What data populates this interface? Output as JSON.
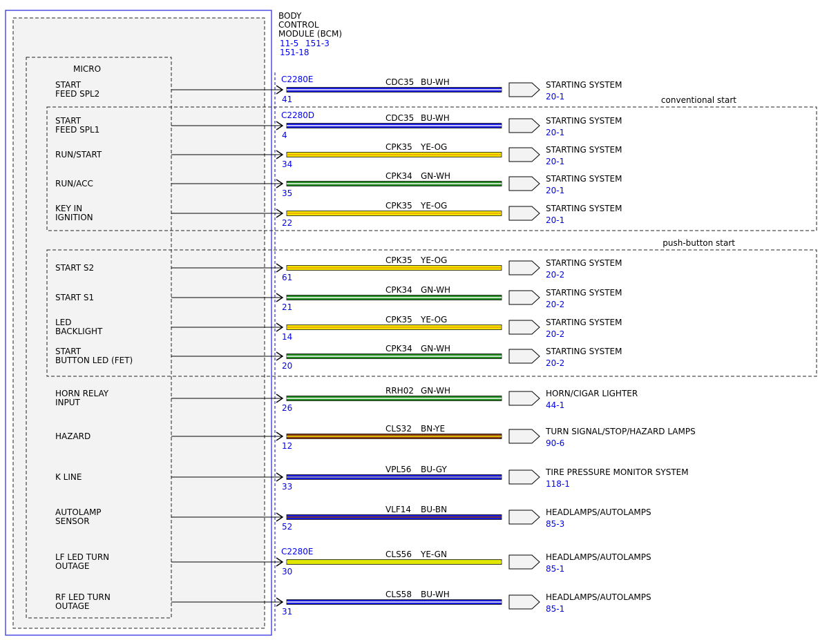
{
  "module": {
    "name_lines": [
      "BODY",
      "CONTROL",
      "MODULE (BCM)"
    ],
    "refs_line1": [
      "11-5",
      "151-3"
    ],
    "refs_line2": "151-18",
    "micro_label": "MICRO"
  },
  "groups": [
    {
      "label": "conventional start"
    },
    {
      "label": "push-button start"
    }
  ],
  "colors": {
    "BU": "#1a1adc",
    "WH": "#ffffff",
    "YE": "#f2e600",
    "OG": "#f0a000",
    "GN": "#1e8a1e",
    "BN": "#8b3a10",
    "GY": "#a8a8a8",
    "YE-GN": "#d6e600",
    "module_border": "#3333dd",
    "ref_text": "#0000ee"
  },
  "circuits": [
    {
      "signal": [
        "START",
        "FEED SPL2"
      ],
      "connector": "C2280E",
      "pin": "41",
      "circuit": "CDC35",
      "wire_color": "BU-WH",
      "dest": "STARTING SYSTEM",
      "ref": "20-1"
    },
    {
      "signal": [
        "START",
        "FEED SPL1"
      ],
      "connector": "C2280D",
      "pin": "4",
      "circuit": "CDC35",
      "wire_color": "BU-WH",
      "dest": "STARTING SYSTEM",
      "ref": "20-1"
    },
    {
      "signal": [
        "RUN/START"
      ],
      "connector": "",
      "pin": "34",
      "circuit": "CPK35",
      "wire_color": "YE-OG",
      "dest": "STARTING SYSTEM",
      "ref": "20-1"
    },
    {
      "signal": [
        "RUN/ACC"
      ],
      "connector": "",
      "pin": "35",
      "circuit": "CPK34",
      "wire_color": "GN-WH",
      "dest": "STARTING SYSTEM",
      "ref": "20-1"
    },
    {
      "signal": [
        "KEY IN",
        "IGNITION"
      ],
      "connector": "",
      "pin": "22",
      "circuit": "CPK35",
      "wire_color": "YE-OG",
      "dest": "STARTING SYSTEM",
      "ref": "20-1"
    },
    {
      "signal": [
        "START S2"
      ],
      "connector": "",
      "pin": "61",
      "circuit": "CPK35",
      "wire_color": "YE-OG",
      "dest": "STARTING SYSTEM",
      "ref": "20-2"
    },
    {
      "signal": [
        "START S1"
      ],
      "connector": "",
      "pin": "21",
      "circuit": "CPK34",
      "wire_color": "GN-WH",
      "dest": "STARTING SYSTEM",
      "ref": "20-2"
    },
    {
      "signal": [
        "LED",
        "BACKLIGHT"
      ],
      "connector": "",
      "pin": "14",
      "circuit": "CPK35",
      "wire_color": "YE-OG",
      "dest": "STARTING SYSTEM",
      "ref": "20-2"
    },
    {
      "signal": [
        "START",
        "BUTTON LED (FET)"
      ],
      "connector": "",
      "pin": "20",
      "circuit": "CPK34",
      "wire_color": "GN-WH",
      "dest": "STARTING SYSTEM",
      "ref": "20-2"
    },
    {
      "signal": [
        "HORN RELAY",
        "INPUT"
      ],
      "connector": "",
      "pin": "26",
      "circuit": "RRH02",
      "wire_color": "GN-WH",
      "dest": "HORN/CIGAR LIGHTER",
      "ref": "44-1"
    },
    {
      "signal": [
        "HAZARD"
      ],
      "connector": "",
      "pin": "12",
      "circuit": "CLS32",
      "wire_color": "BN-YE",
      "dest": "TURN SIGNAL/STOP/HAZARD LAMPS",
      "ref": "90-6"
    },
    {
      "signal": [
        "K LINE"
      ],
      "connector": "",
      "pin": "33",
      "circuit": "VPL56",
      "wire_color": "BU-GY",
      "dest": "TIRE PRESSURE MONITOR SYSTEM",
      "ref": "118-1"
    },
    {
      "signal": [
        "AUTOLAMP",
        "SENSOR"
      ],
      "connector": "",
      "pin": "52",
      "circuit": "VLF14",
      "wire_color": "BU-BN",
      "dest": "HEADLAMPS/AUTOLAMPS",
      "ref": "85-3"
    },
    {
      "signal": [
        "LF LED TURN",
        "OUTAGE"
      ],
      "connector": "C2280E",
      "pin": "30",
      "circuit": "CLS56",
      "wire_color": "YE-GN",
      "dest": "HEADLAMPS/AUTOLAMPS",
      "ref": "85-1"
    },
    {
      "signal": [
        "RF LED TURN",
        "OUTAGE"
      ],
      "connector": "",
      "pin": "31",
      "circuit": "CLS58",
      "wire_color": "BU-WH",
      "dest": "HEADLAMPS/AUTOLAMPS",
      "ref": "85-1"
    }
  ]
}
